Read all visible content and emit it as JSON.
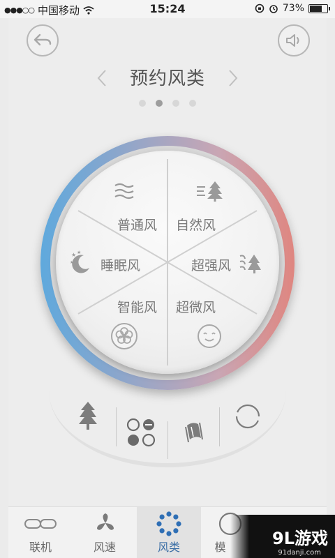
{
  "status_bar": {
    "signal": "●●●○○",
    "carrier": "中国移动",
    "time": "15:24",
    "battery_text": "73%",
    "battery_level": 0.73
  },
  "header": {
    "back_icon": "back-arrow-icon",
    "sound_icon": "speaker-icon",
    "title": "预约风类",
    "page_count": 4,
    "active_page": 1
  },
  "dial": {
    "ring_colors": [
      "#5fa9dd",
      "#df8680"
    ],
    "segments": [
      {
        "label": "普通风",
        "icon": "wind-lines-icon"
      },
      {
        "label": "自然风",
        "icon": "tree-wind-icon"
      },
      {
        "label": "超强风",
        "icon": "strong-wind-tree-icon"
      },
      {
        "label": "超微风",
        "icon": "smile-face-icon"
      },
      {
        "label": "智能风",
        "icon": "flower-icon"
      },
      {
        "label": "睡眠风",
        "icon": "moon-stars-icon"
      }
    ]
  },
  "controls": [
    {
      "icon": "tree-icon"
    },
    {
      "icon": "grid-dots-icon"
    },
    {
      "icon": "swing-icon"
    },
    {
      "icon": "circle-arrows-icon"
    }
  ],
  "tabs": [
    {
      "label": "联机",
      "icon": "link-icon"
    },
    {
      "label": "风速",
      "icon": "fan-icon"
    },
    {
      "label": "风类",
      "icon": "flower-dots-icon",
      "active": true
    },
    {
      "label": "模",
      "icon": "mode-icon"
    }
  ],
  "watermark": {
    "brand": "9L游戏",
    "site": "91danji.com"
  }
}
